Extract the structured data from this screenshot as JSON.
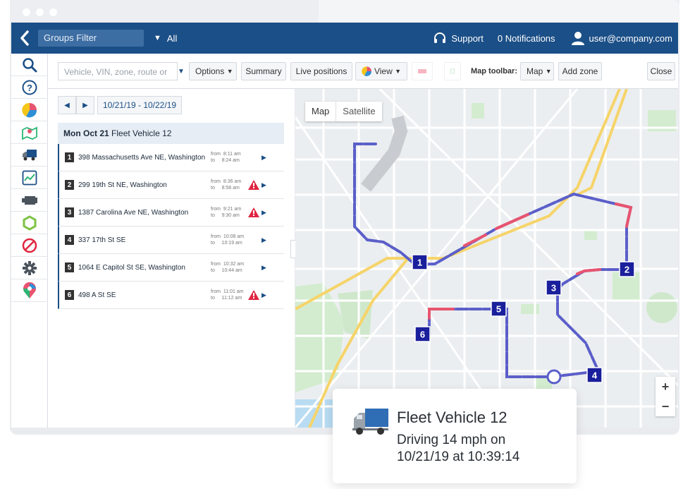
{
  "topbar": {
    "groups_filter": "Groups Filter",
    "groups_value": "All",
    "support": "Support",
    "notifications": "0 Notifications",
    "user": "user@company.com",
    "bar_color": "#1b4f87"
  },
  "toolbar": {
    "search_placeholder": "Vehicle, VIN, zone, route or",
    "options": "Options",
    "summary": "Summary",
    "live_positions": "Live positions",
    "view": "View",
    "map_toolbar_label": "Map toolbar:",
    "map": "Map",
    "add_zone": "Add zone",
    "close": "Close"
  },
  "sidebar": {
    "icons": [
      "search-icon",
      "help-icon",
      "pie-chart-icon",
      "map-icon",
      "truck-icon",
      "trend-chart-icon",
      "engine-icon",
      "zone-icon",
      "block-icon",
      "gear-icon",
      "location-pin-icon"
    ]
  },
  "trip": {
    "date_range": "10/21/19 - 10/22/19",
    "day_label": "Mon Oct 21",
    "vehicle": "Fleet Vehicle 12",
    "stops": [
      {
        "num": "1",
        "address": "398 Massachusetts Ave NE, Washington",
        "from": "8:11 am",
        "to": "8:24 am",
        "warning": false
      },
      {
        "num": "2",
        "address": "299 19th St NE, Washington",
        "from": "8:36 am",
        "to": "8:58 am",
        "warning": true
      },
      {
        "num": "3",
        "address": "1387 Carolina Ave NE, Washington",
        "from": "9:21 am",
        "to": "9:30 am",
        "warning": true
      },
      {
        "num": "4",
        "address": "337 17th St SE",
        "from": "10:08 am",
        "to": "10:19 am",
        "warning": false
      },
      {
        "num": "5",
        "address": "1064 E Capitol St SE, Washington",
        "from": "10:32 am",
        "to": "10:44 am",
        "warning": false
      },
      {
        "num": "6",
        "address": "498 A St SE",
        "from": "11:01 am",
        "to": "11:12 am",
        "warning": true
      }
    ],
    "from_label": "from",
    "to_label": "to"
  },
  "map": {
    "type_map": "Map",
    "type_satellite": "Satellite",
    "zoom_in": "+",
    "zoom_out": "−",
    "markers": [
      "1",
      "2",
      "3",
      "4",
      "5",
      "6"
    ],
    "route_color": "#5b5fc9",
    "speeding_color": "#e8546f"
  },
  "card": {
    "title": "Fleet Vehicle 12",
    "line1": "Driving 14 mph on",
    "line2": "10/21/19 at 10:39:14"
  }
}
